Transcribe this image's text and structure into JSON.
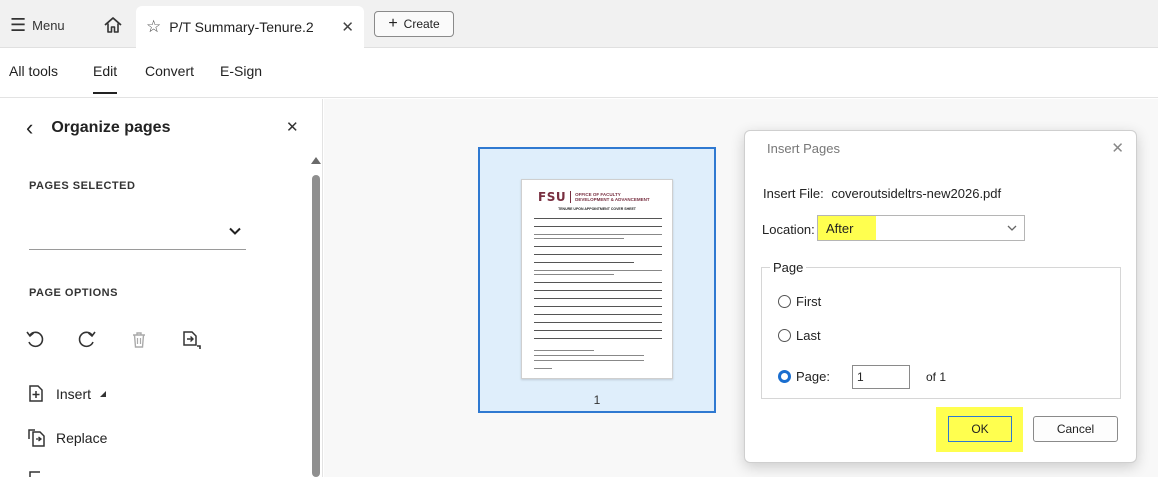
{
  "tabbar": {
    "menu_label": "Menu",
    "document_tab_title": "P/T Summary-Tenure.2",
    "create_label": "Create"
  },
  "toolbar": {
    "tabs": [
      {
        "label": "All tools"
      },
      {
        "label": "Edit",
        "active": true
      },
      {
        "label": "Convert"
      },
      {
        "label": "E-Sign"
      }
    ]
  },
  "panel": {
    "title": "Organize pages",
    "pages_selected_label": "PAGES SELECTED",
    "page_options_label": "PAGE OPTIONS",
    "actions": [
      {
        "label": "Insert"
      },
      {
        "label": "Replace"
      }
    ],
    "icons": [
      "undo-icon",
      "redo-icon",
      "delete-icon",
      "extract-icon"
    ]
  },
  "thumbnail": {
    "page_number": "1",
    "logo_mark": "FSU",
    "logo_line1": "OFFICE OF FACULTY",
    "logo_line2": "DEVELOPMENT & ADVANCEMENT",
    "subtitle": "TENURE UPON APPOINTMENT COVER SHEET"
  },
  "dialog": {
    "title": "Insert Pages",
    "insert_file_label": "Insert File:",
    "insert_file_name": "coveroutsideltrs-new2026.pdf",
    "location_label": "Location:",
    "location_value": "After",
    "page_group_label": "Page",
    "radio_first": "First",
    "radio_last": "Last",
    "radio_page": "Page:",
    "selected_radio": "Page:",
    "page_input_value": "1",
    "of_label": "of 1",
    "ok_label": "OK",
    "cancel_label": "Cancel"
  },
  "colors": {
    "accent_blue": "#2f79d1",
    "highlight_yellow": "#ffff4f",
    "fsu_garnet": "#782f40"
  }
}
